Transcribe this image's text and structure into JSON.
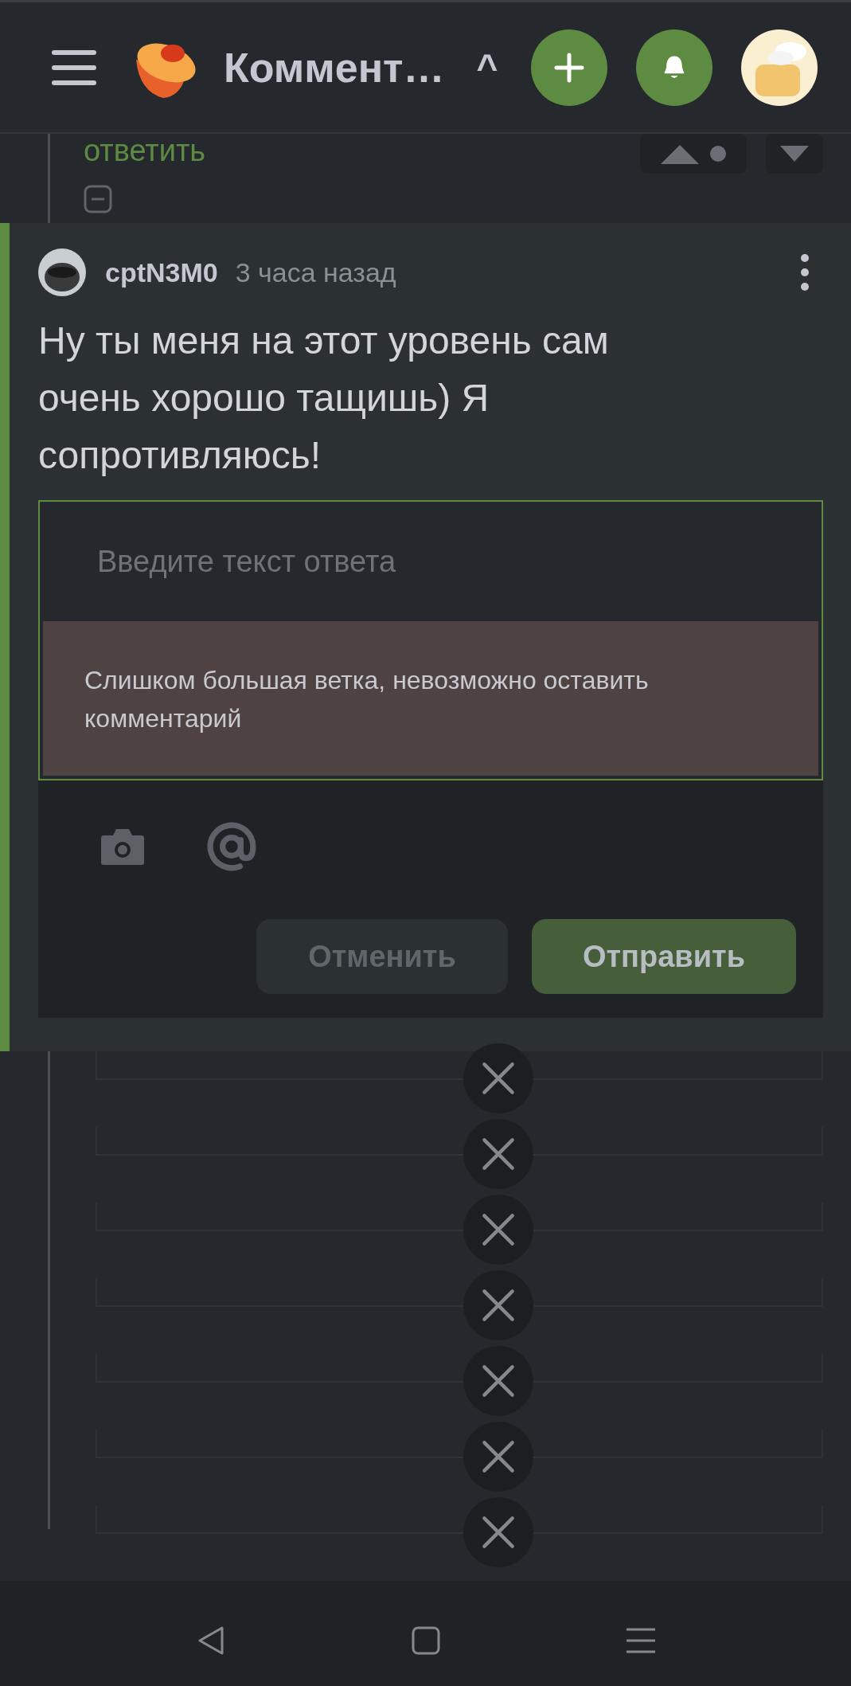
{
  "header": {
    "title": "Коммент…",
    "collapse_glyph": "^"
  },
  "parent_comment": {
    "reply_link": "ответить"
  },
  "comment": {
    "author": "cptN3M0",
    "time": "3 часа назад",
    "text": "Ну ты меня на этот уровень сам очень хорошо тащишь) Я сопротивляюсь!"
  },
  "reply_form": {
    "placeholder": "Введите текст ответа",
    "error": "Слишком большая ветка, невозможно оставить комментарий",
    "buttons": [
      {
        "label": "Отменить",
        "kind": "cancel"
      },
      {
        "label": "Отправить",
        "kind": "submit"
      }
    ]
  },
  "collapsed_replies": [
    {
      "kind": "hidden"
    },
    {
      "kind": "hidden"
    },
    {
      "kind": "hidden"
    },
    {
      "kind": "hidden"
    },
    {
      "kind": "hidden"
    },
    {
      "kind": "hidden"
    },
    {
      "kind": "hidden"
    }
  ]
}
